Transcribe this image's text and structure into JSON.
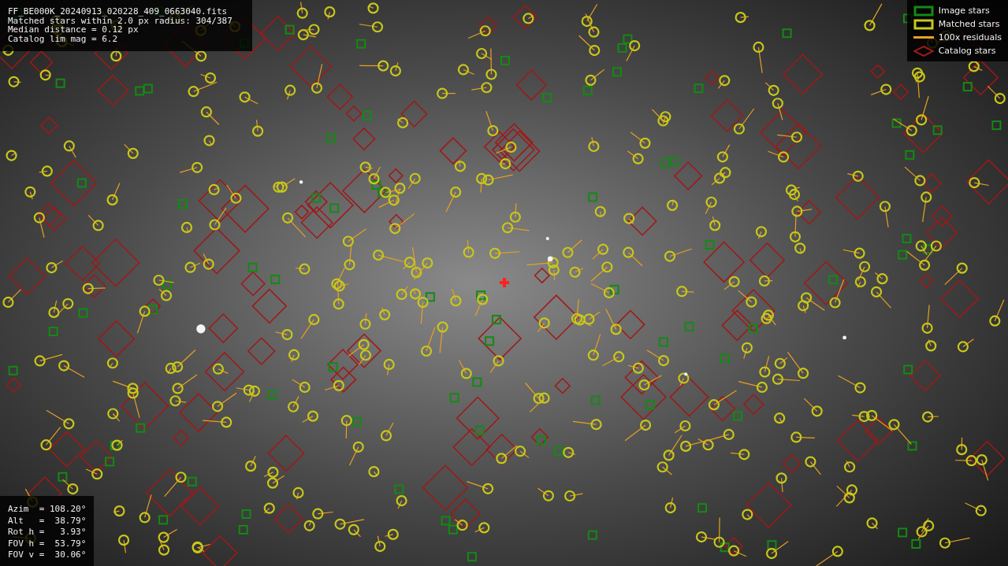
{
  "header": {
    "lines": [
      "FF_BE000K_20240913_020228_409_0663040.fits",
      "Matched stars within 2.0 px radius: 304/387",
      "Median distance = 0.12 px",
      "Catalog lim mag = 6.2"
    ]
  },
  "legend": [
    {
      "label": "Image stars",
      "kind": "box",
      "color": "#138a13"
    },
    {
      "label": "Matched stars",
      "kind": "box",
      "color": "#c8c81a"
    },
    {
      "label": "100x residuals",
      "kind": "line",
      "color": "#e8a020"
    },
    {
      "label": "Catalog stars",
      "kind": "diamond",
      "color": "#a01818"
    }
  ],
  "pointing": {
    "lines": [
      "Azim  = 108.20°",
      "Alt   =  38.79°",
      "Rot h =   3.93°",
      "FOV h =  53.79°",
      "FOV v =  30.06°"
    ]
  }
}
